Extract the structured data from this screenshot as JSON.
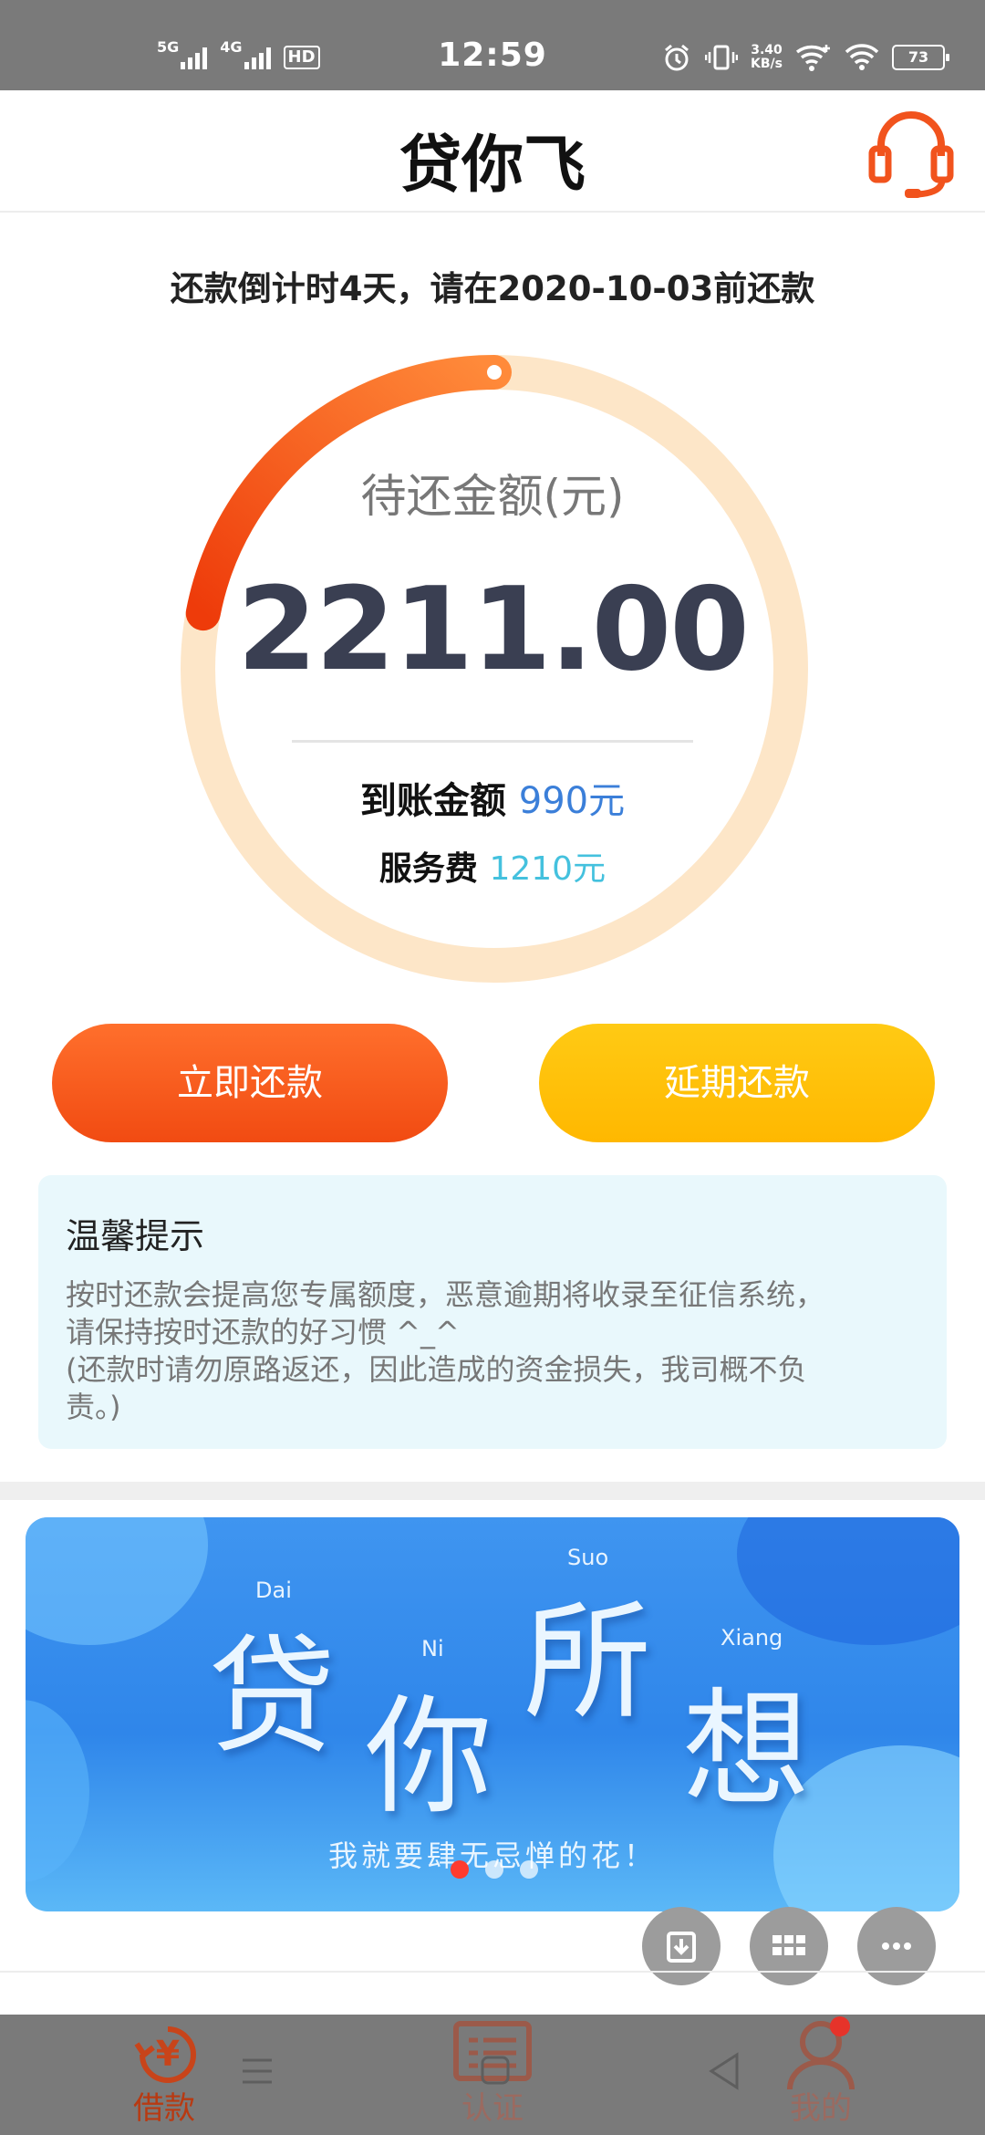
{
  "status_bar": {
    "net1": "5G",
    "net2": "4G",
    "hd": "HD",
    "time": "12:59",
    "speed_value": "3.40",
    "speed_unit": "KB/s",
    "battery": "73"
  },
  "header": {
    "title": "贷你飞"
  },
  "countdown": "还款倒计时4天，请在2020-10-03前还款",
  "summary": {
    "due_label": "待还金额(元)",
    "due_amount": "2211.00",
    "received_label": "到账金额",
    "received_value": "990元",
    "fee_label": "服务费",
    "fee_value": "1210元",
    "progress_fraction": 0.22
  },
  "actions": {
    "pay_now": "立即还款",
    "defer": "延期还款"
  },
  "tips": {
    "title": "温馨提示",
    "line1": "按时还款会提高您专属额度，恶意逾期将收录至征信系统，",
    "line2": "请保持按时还款的好习惯 ^_^",
    "line3": "(还款时请勿原路返还，因此造成的资金损失，我司概不负",
    "line4": "责。)"
  },
  "banner": {
    "char1": "贷",
    "char2": "你",
    "char3": "所",
    "char4": "想",
    "py1": "Dai",
    "py2": "Ni",
    "py3": "Suo",
    "py4": "Xiang",
    "slogan": "我就要肆无忌惮的花！",
    "slides": 3,
    "active_slide": 1
  },
  "bottom_nav": {
    "items": [
      {
        "label": "借款",
        "icon": "yen-refresh-icon"
      },
      {
        "label": "认证",
        "icon": "id-card-icon"
      },
      {
        "label": "我的",
        "icon": "user-icon"
      }
    ]
  },
  "colors": {
    "accent": "#f5541a",
    "accent_yellow": "#ffbf08",
    "ring_track": "#fde6c8",
    "amount": "#3a3f52",
    "received": "#3b7fd9",
    "fee": "#44c1de"
  }
}
